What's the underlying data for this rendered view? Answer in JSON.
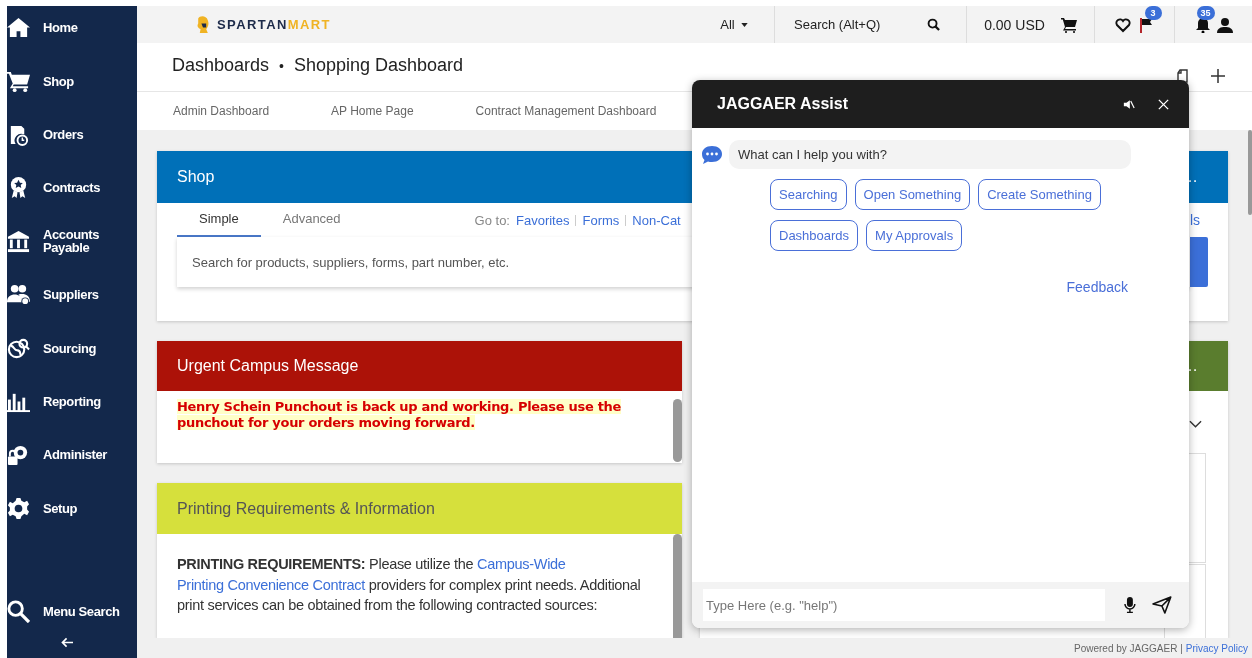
{
  "sidebar": {
    "items": [
      {
        "label": "Home"
      },
      {
        "label": "Shop"
      },
      {
        "label": "Orders"
      },
      {
        "label": "Contracts"
      },
      {
        "label": "Accounts Payable"
      },
      {
        "label": "Suppliers"
      },
      {
        "label": "Sourcing"
      },
      {
        "label": "Reporting"
      },
      {
        "label": "Administer"
      },
      {
        "label": "Setup"
      }
    ],
    "menu_search": "Menu Search"
  },
  "top_bar": {
    "logo": [
      "SPARTAN",
      "MART"
    ],
    "scope": "All",
    "search": {
      "placeholder": "Search (Alt+Q)"
    },
    "cart_total": "0.00 USD",
    "flag_badge": "3",
    "notification_badge": "35"
  },
  "breadcrumb": {
    "items": [
      "Dashboards",
      "Shopping Dashboard"
    ],
    "separator": "•"
  },
  "dashboard_tabs": [
    {
      "label": "Admin Dashboard",
      "selected": false
    },
    {
      "label": "AP Home Page",
      "selected": false
    },
    {
      "label": "Contract Management Dashboard",
      "selected": false
    }
  ],
  "shop_widget": {
    "title": "Shop",
    "more": "…",
    "tabs": [
      {
        "label": "Simple",
        "selected": true
      },
      {
        "label": "Advanced",
        "selected": false
      }
    ],
    "goto_label": "Go to:",
    "goto_links": [
      "Favorites",
      "Forms",
      "Non-Cat"
    ],
    "link_fragment": "ls",
    "search": {
      "placeholder": "Search for products, suppliers, forms, part number, etc."
    }
  },
  "urgent_message": {
    "title": "Urgent Campus Message",
    "message": "Henry Schein Punchout is back up and working. Please use the punchout for your orders moving forward."
  },
  "printing": {
    "title": "Printing Requirements & Information",
    "body": [
      {
        "kind": "bold",
        "text": "PRINTING REQUIREMENTS:"
      },
      {
        "kind": "plain",
        "text": " Please utilize the "
      },
      {
        "kind": "link",
        "text": "Campus-Wide"
      },
      {
        "kind": "link",
        "text": "Printing Convenience Contract"
      },
      {
        "kind": "plain",
        "text": " providers for complex print needs. Additional print services can be obtained from the following contracted sources:"
      }
    ]
  },
  "right_widget": {
    "more": "…"
  },
  "chat": {
    "title": "JAGGAER Assist",
    "bot_message": "What can I help you with?",
    "quick_replies": [
      "Searching",
      "Open Something",
      "Create Something",
      "Dashboards",
      "My Approvals"
    ],
    "feedback": "Feedback",
    "input": {
      "placeholder": "Type Here (e.g. \"help\")"
    }
  },
  "footer": {
    "text": "Powered by JAGGAER |",
    "link": "Privacy Policy"
  }
}
